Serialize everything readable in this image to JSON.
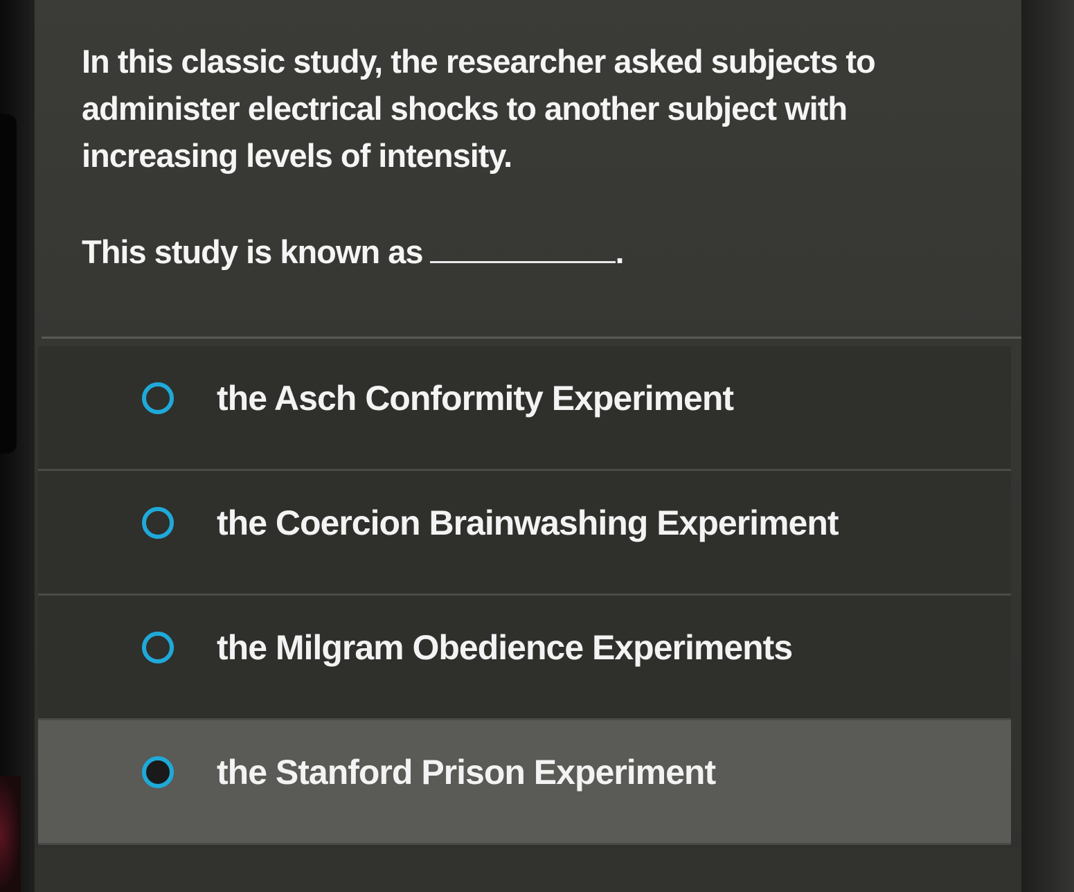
{
  "question": {
    "text": "In this classic study, the researcher asked subjects to administer electrical shocks to another subject with increasing levels of intensity.",
    "prompt": "This study is known as",
    "prompt_end": "."
  },
  "options": [
    {
      "label": "the Asch Conformity Experiment",
      "selected": false
    },
    {
      "label": "the Coercion Brainwashing Experiment",
      "selected": false
    },
    {
      "label": "the Milgram Obedience Experiments",
      "selected": false
    },
    {
      "label": "the Stanford Prison Experiment",
      "selected": false
    }
  ],
  "colors": {
    "accent": "#1fa9d9",
    "background": "#363633",
    "highlight": "#5a5a56",
    "text": "#f5f5f5"
  }
}
